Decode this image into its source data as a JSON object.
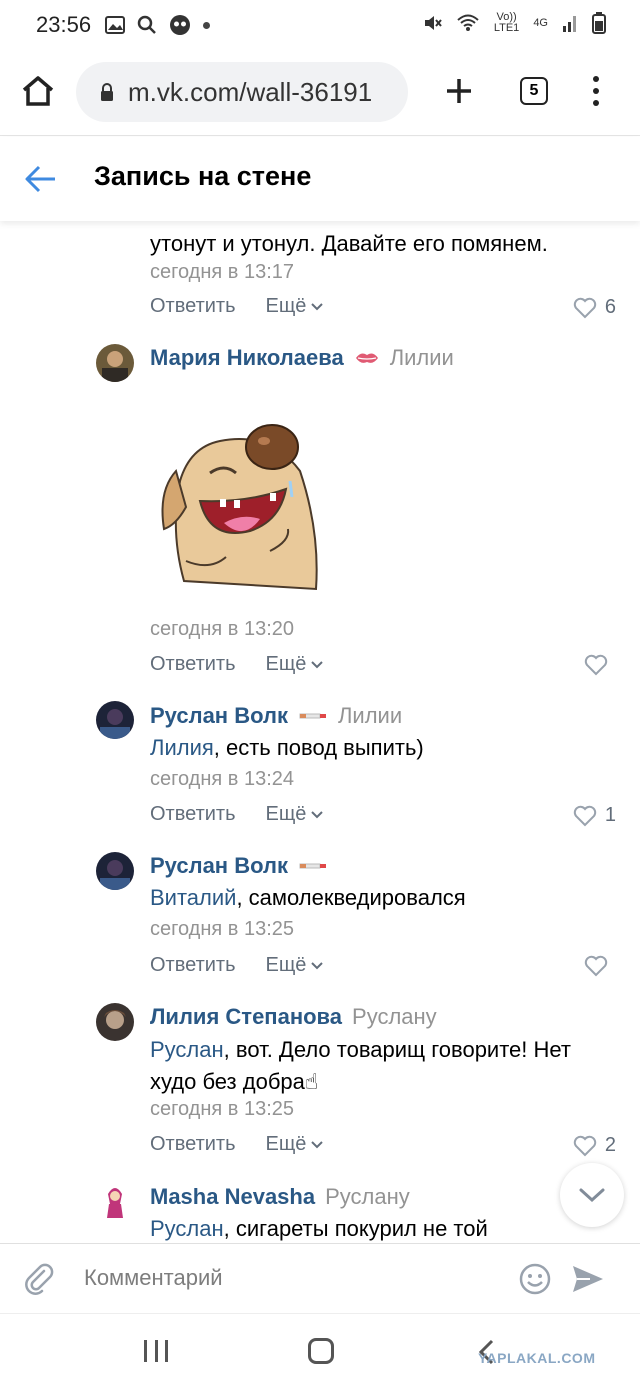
{
  "status_bar": {
    "time": "23:56",
    "network_top": "Vo))",
    "network_bottom": "LTE1",
    "signal_label": "4G"
  },
  "browser": {
    "url": "m.vk.com/wall-36191",
    "tab_count": "5"
  },
  "header": {
    "title": "Запись на стене"
  },
  "partial_comment": {
    "text": "утонут и утонул. Давайте его помянем.",
    "time": "сегодня в 13:17",
    "reply_label": "Ответить",
    "more_label": "Ещё",
    "likes": "6"
  },
  "comments": [
    {
      "author": "Мария Николаева",
      "reply_to": "Лилии",
      "time": "сегодня в 13:20",
      "reply_label": "Ответить",
      "more_label": "Ещё",
      "likes": ""
    },
    {
      "author": "Руслан Волк",
      "reply_to": "Лилии",
      "mention": "Лилия",
      "text": ", есть повод выпить)",
      "time": "сегодня в 13:24",
      "reply_label": "Ответить",
      "more_label": "Ещё",
      "likes": "1"
    },
    {
      "author": "Руслан Волк",
      "reply_to": "",
      "mention": "Виталий",
      "text": ", самолекведировался",
      "time": "сегодня в 13:25",
      "reply_label": "Ответить",
      "more_label": "Ещё",
      "likes": ""
    },
    {
      "author": "Лилия Степанова",
      "reply_to": "Руслану",
      "mention": "Руслан",
      "text": ", вот. Дело товарищ говорите! Нет худо без добра☝",
      "time": "сегодня в 13:25",
      "reply_label": "Ответить",
      "more_label": "Ещё",
      "likes": "2"
    },
    {
      "author": "Masha Nevasha",
      "reply_to": "Руслану",
      "mention": "Руслан",
      "text": ", сигареты покурил не той",
      "time": "",
      "reply_label": "",
      "more_label": "",
      "likes": ""
    }
  ],
  "comment_bar": {
    "placeholder": "Комментарий"
  },
  "watermark": "YAPLAKAL.COM",
  "colors": {
    "link": "#2a5885",
    "meta": "#939393",
    "action": "#626d7a",
    "accent": "#3f8ae0"
  },
  "icons": [
    "home-icon",
    "lock-icon",
    "plus-icon",
    "tabs-icon",
    "menu-icon",
    "back-arrow-icon",
    "heart-icon",
    "chevron-down-icon",
    "paperclip-icon",
    "smile-icon",
    "send-icon"
  ]
}
